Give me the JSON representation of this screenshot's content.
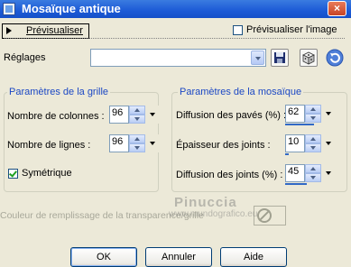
{
  "window": {
    "title": "Mosaïque antique",
    "close_label": "×"
  },
  "preview": {
    "button_label": "Prévisualiser",
    "checkbox_label": "Prévisualiser l'image",
    "checkbox_checked": false
  },
  "presets": {
    "label": "Réglages",
    "value": ""
  },
  "grid_group": {
    "title": "Paramètres de la grille",
    "columns_label": "Nombre de colonnes :",
    "columns_value": "96",
    "rows_label": "Nombre de lignes :",
    "rows_value": "96",
    "symmetric_label": "Symétrique",
    "symmetric_checked": true
  },
  "mosaic_group": {
    "title": "Paramètres de la mosaïque",
    "tile_diffusion_label": "Diffusion des pavés (%) :",
    "tile_diffusion_value": "62",
    "joint_thickness_label": "Épaisseur des joints :",
    "joint_thickness_value": "10",
    "joint_diffusion_label": "Diffusion des joints (%) :",
    "joint_diffusion_value": "45"
  },
  "fill": {
    "label": "Couleur de remplissage de la transparence/grille"
  },
  "watermark": {
    "line1": "Pinuccia",
    "line2": "www.mundografico.eu"
  },
  "buttons": {
    "ok": "OK",
    "cancel": "Annuler",
    "help": "Aide"
  },
  "colors": {
    "titlebar": "#1c5ad6",
    "group_title": "#1c48c4",
    "dialog_bg": "#ece9d8"
  },
  "icons": [
    "save-icon",
    "dice-icon",
    "reset-icon",
    "no-fill-icon"
  ]
}
